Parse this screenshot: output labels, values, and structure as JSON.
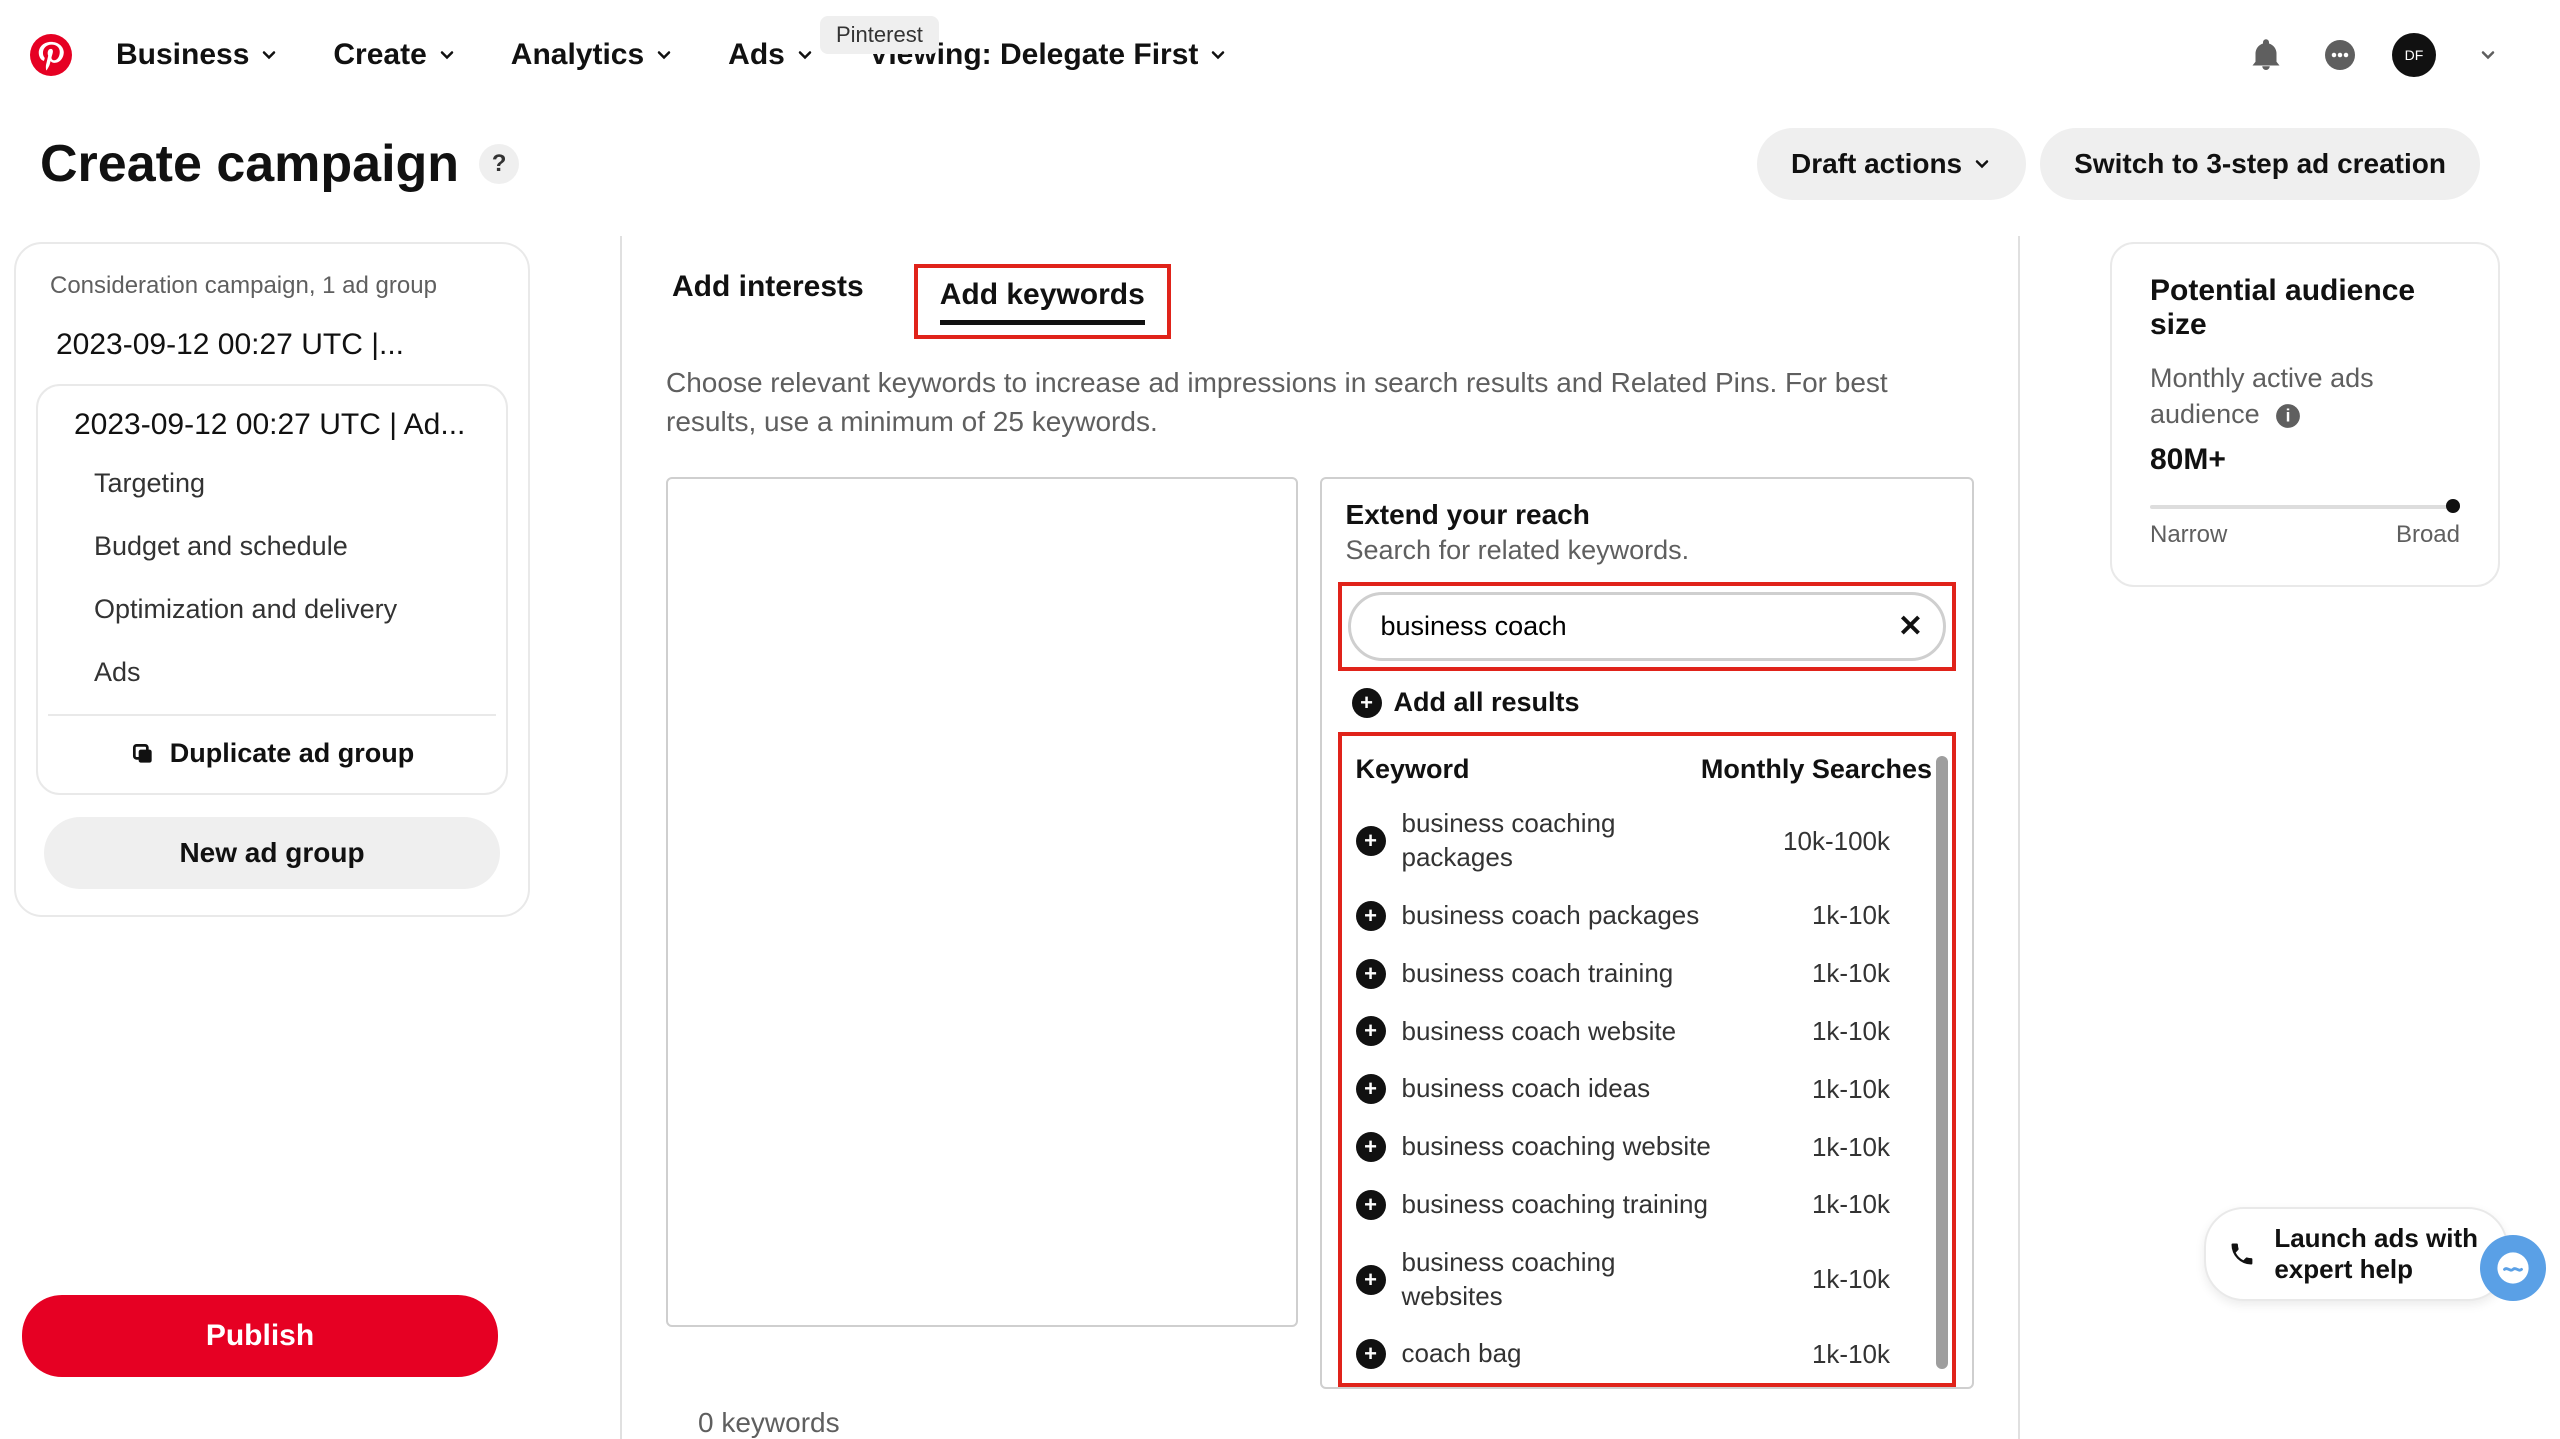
{
  "nav": {
    "tooltip": "Pinterest",
    "items": [
      "Business",
      "Create",
      "Analytics",
      "Ads"
    ],
    "viewing_prefix": "Viewing: ",
    "viewing_value": "Delegate First"
  },
  "page": {
    "title": "Create campaign",
    "help": "?",
    "draft_actions": "Draft actions",
    "switch_mode": "Switch to 3-step ad creation"
  },
  "sidebar": {
    "campaign_meta": "Consideration campaign, 1 ad group",
    "campaign_name": "2023-09-12 00:27 UTC |...",
    "adgroup_name": "2023-09-12 00:27 UTC | Ad...",
    "links": [
      "Targeting",
      "Budget and schedule",
      "Optimization and delivery",
      "Ads"
    ],
    "duplicate": "Duplicate ad group",
    "new_adgroup": "New ad group",
    "publish": "Publish"
  },
  "tabs": {
    "interests": "Add interests",
    "keywords": "Add keywords"
  },
  "center": {
    "description": "Choose relevant keywords to increase ad impressions in search results and Related Pins. For best results, use a minimum of 25 keywords.",
    "keyword_count": "0 keywords"
  },
  "extend": {
    "heading": "Extend your reach",
    "sub": "Search for related keywords.",
    "search_value": "business coach",
    "add_all": "Add all results",
    "col_keyword": "Keyword",
    "col_searches": "Monthly Searches",
    "rows": [
      {
        "kw": "business coaching packages",
        "ms": "10k-100k"
      },
      {
        "kw": "business coach packages",
        "ms": "1k-10k"
      },
      {
        "kw": "business coach training",
        "ms": "1k-10k"
      },
      {
        "kw": "business coach website",
        "ms": "1k-10k"
      },
      {
        "kw": "business coach ideas",
        "ms": "1k-10k"
      },
      {
        "kw": "business coaching website",
        "ms": "1k-10k"
      },
      {
        "kw": "business coaching training",
        "ms": "1k-10k"
      },
      {
        "kw": "business coaching websites",
        "ms": "1k-10k"
      },
      {
        "kw": "coach bag",
        "ms": "1k-10k"
      }
    ]
  },
  "audience": {
    "title": "Potential audience size",
    "sub": "Monthly active ads audience",
    "value": "80M+",
    "scale_narrow": "Narrow",
    "scale_broad": "Broad"
  },
  "launch": {
    "line1": "Launch ads with",
    "line2": "expert help"
  }
}
